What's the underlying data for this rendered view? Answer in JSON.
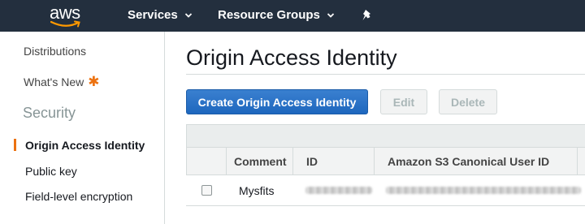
{
  "topnav": {
    "logo_text": "aws",
    "services_label": "Services",
    "resource_groups_label": "Resource Groups",
    "pin_icon": "pushpin-icon",
    "bg_color": "#232f3e"
  },
  "sidebar": {
    "distributions": "Distributions",
    "whats_new": "What's New",
    "whats_new_badge": "✱",
    "security_heading": "Security",
    "items": [
      {
        "label": "Origin Access Identity",
        "active": true
      },
      {
        "label": "Public key",
        "active": false
      },
      {
        "label": "Field-level encryption",
        "active": false
      }
    ],
    "accent_color": "#ec7211"
  },
  "main": {
    "title": "Origin Access Identity",
    "buttons": {
      "create": "Create Origin Access Identity",
      "edit": "Edit",
      "delete": "Delete"
    },
    "table": {
      "columns": [
        "Comment",
        "ID",
        "Amazon S3 Canonical User ID"
      ],
      "rows": [
        {
          "comment": "Mysfits",
          "id_obscured": true,
          "canonical_obscured": true
        }
      ]
    }
  }
}
